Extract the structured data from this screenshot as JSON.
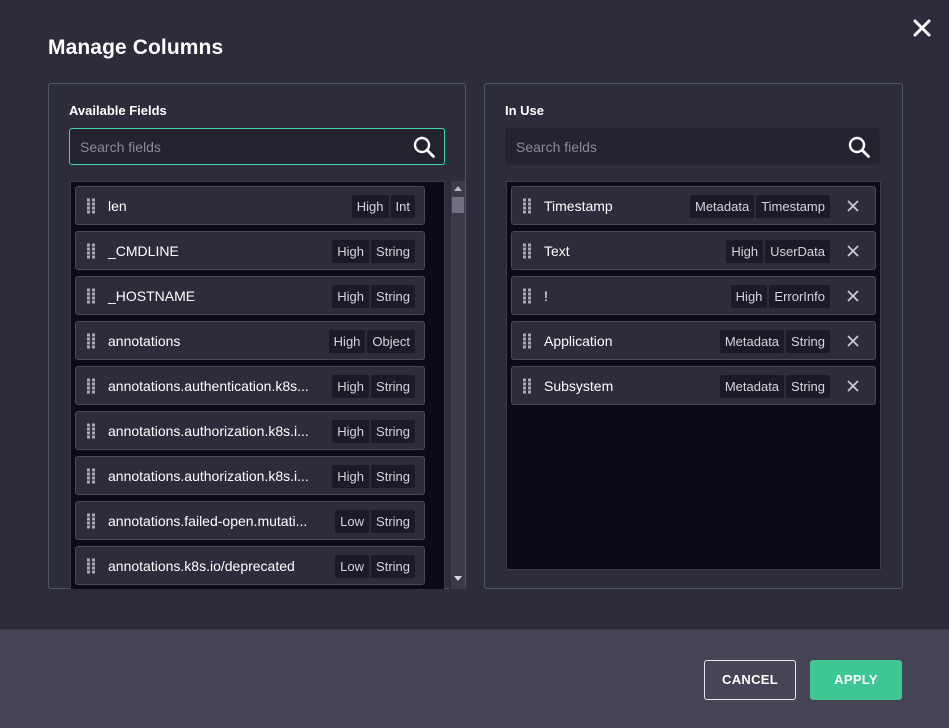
{
  "dialog": {
    "title": "Manage Columns"
  },
  "available": {
    "title": "Available Fields",
    "search_placeholder": "Search fields",
    "items": [
      {
        "name": "len",
        "tags": [
          "High",
          "Int"
        ]
      },
      {
        "name": "_CMDLINE",
        "tags": [
          "High",
          "String"
        ]
      },
      {
        "name": "_HOSTNAME",
        "tags": [
          "High",
          "String"
        ]
      },
      {
        "name": "annotations",
        "tags": [
          "High",
          "Object"
        ]
      },
      {
        "name": "annotations.authentication.k8s...",
        "tags": [
          "High",
          "String"
        ]
      },
      {
        "name": "annotations.authorization.k8s.i...",
        "tags": [
          "High",
          "String"
        ]
      },
      {
        "name": "annotations.authorization.k8s.i...",
        "tags": [
          "High",
          "String"
        ]
      },
      {
        "name": "annotations.failed-open.mutati...",
        "tags": [
          "Low",
          "String"
        ]
      },
      {
        "name": "annotations.k8s.io/deprecated",
        "tags": [
          "Low",
          "String"
        ]
      }
    ]
  },
  "in_use": {
    "title": "In Use",
    "search_placeholder": "Search fields",
    "items": [
      {
        "name": "Timestamp",
        "tags": [
          "Metadata",
          "Timestamp"
        ]
      },
      {
        "name": "Text",
        "tags": [
          "High",
          "UserData"
        ]
      },
      {
        "name": "!",
        "tags": [
          "High",
          "ErrorInfo"
        ]
      },
      {
        "name": "Application",
        "tags": [
          "Metadata",
          "String"
        ]
      },
      {
        "name": "Subsystem",
        "tags": [
          "Metadata",
          "String"
        ]
      }
    ]
  },
  "footer": {
    "cancel_label": "CANCEL",
    "apply_label": "APPLY"
  },
  "colors": {
    "background": "#2c2c3a",
    "accent": "#3ec793",
    "search_focus_border": "#3ed6a4",
    "list_background": "#0c0a17",
    "footer": "#454556"
  },
  "icons": {
    "close": "close-icon",
    "search": "search-icon",
    "drag": "drag-handle-icon",
    "remove": "remove-icon"
  }
}
